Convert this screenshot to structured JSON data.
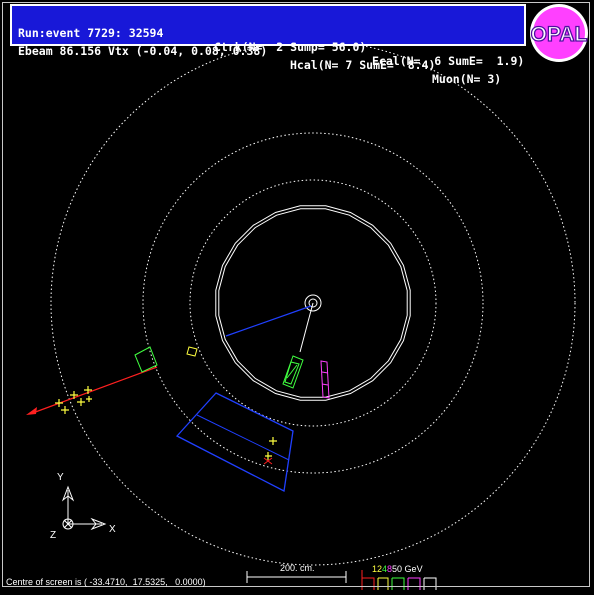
{
  "header": {
    "run_event": "Run:event 7729: 32594",
    "ctrk": "Ctrk(N=  2 Sump= 56.0)",
    "ecal": "Ecal(N=  6 SumE=  1.9)",
    "ebeam_vtx": "Ebeam 86.156 Vtx (-0.04, 0.08, 0.38)",
    "hcal": "Hcal(N= 7 SumE=  8.4)",
    "muon": "Muon(N= 3)"
  },
  "logo_text": "OPAL",
  "axes": {
    "y": "Y",
    "x": "X",
    "z": "Z"
  },
  "scale_bar": {
    "label": "200. cm."
  },
  "energy_legend": {
    "items": [
      {
        "text": "12",
        "color": "#ffff40"
      },
      {
        "text": "4",
        "color": "#40ff40"
      },
      {
        "text": "8",
        "color": "#ff40ff"
      },
      {
        "text": "50 GeV",
        "color": "#ffffff"
      }
    ]
  },
  "footer": {
    "centre_text": "Centre of screen is ( -33.4710,  17.5325,   0.0000)"
  },
  "colors": {
    "background": "#000000",
    "header_bg": "#1818d8",
    "track_blue": "#2040ff",
    "track_red": "#ff2020",
    "ecal_green": "#40ff40",
    "hcal_magenta": "#ff40ff",
    "muon_yellow": "#ffff40"
  }
}
